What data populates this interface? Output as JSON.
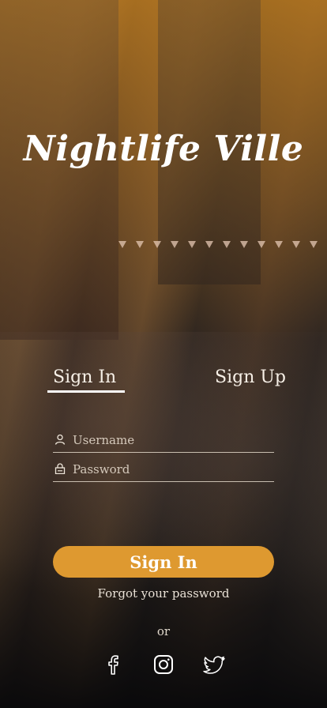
{
  "app": {
    "title": "Nightlife Ville"
  },
  "tabs": {
    "sign_in": "Sign In",
    "sign_up": "Sign Up",
    "active": "Sign In"
  },
  "form": {
    "username_placeholder": "Username",
    "password_placeholder": "Password",
    "username_value": "",
    "password_value": ""
  },
  "actions": {
    "sign_in_button": "Sign In",
    "forgot_password": "Forgot your password",
    "or": "or"
  },
  "social": [
    "facebook-icon",
    "instagram-icon",
    "twitter-icon"
  ],
  "colors": {
    "accent": "#de9930",
    "text": "#f3ece2"
  }
}
